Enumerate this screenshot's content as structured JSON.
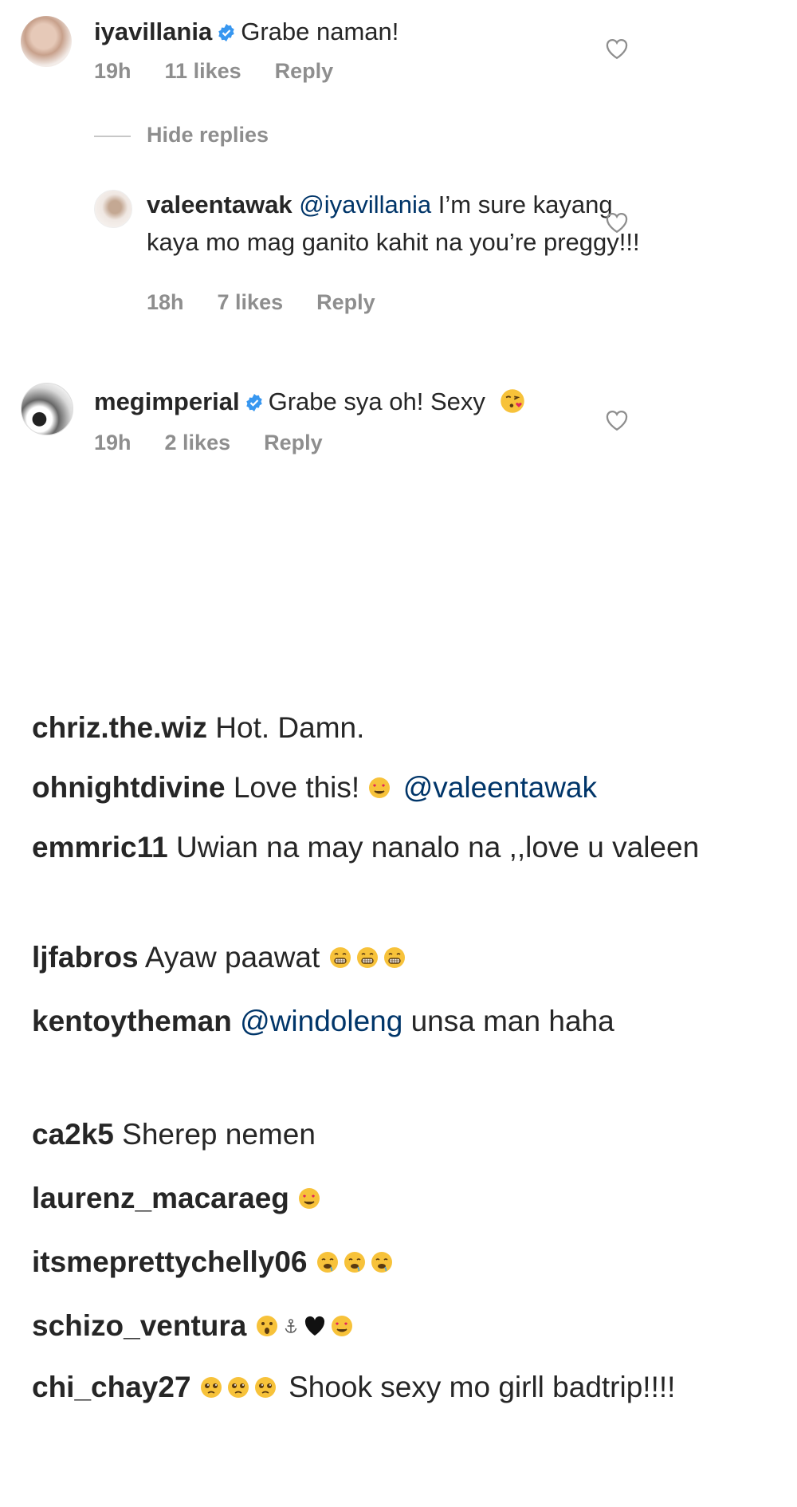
{
  "comments_threaded": [
    {
      "username": "iyavillania",
      "verified": true,
      "text": "Grabe naman!",
      "time": "19h",
      "likes": "11 likes",
      "reply_label": "Reply",
      "hide_replies_label": "Hide replies",
      "replies": [
        {
          "username": "valeentawak",
          "mention": "@iyavillania",
          "text": "I’m sure kayang kaya mo mag ganito kahit na you’re preggy!!!",
          "time": "18h",
          "likes": "7 likes",
          "reply_label": "Reply"
        }
      ]
    },
    {
      "username": "megimperial",
      "verified": true,
      "text": "Grabe sya oh! Sexy",
      "emoji": "kiss-face",
      "time": "19h",
      "likes": "2 likes",
      "reply_label": "Reply"
    }
  ],
  "comments_plain": [
    {
      "username": "chriz.the.wiz",
      "text": "Hot. Damn."
    },
    {
      "username": "ohnightdivine",
      "text": "Love this!",
      "emoji": "heart-eyes",
      "mention": "@valeentawak"
    },
    {
      "username": "emmric11",
      "text": "Uwian na may nanalo na ,,love u valeen"
    },
    {
      "username": "ljfabros",
      "text": "Ayaw paawat",
      "emoji": "grimace x3"
    },
    {
      "username": "kentoytheman",
      "mention": "@windoleng",
      "text": "unsa man haha"
    },
    {
      "username": "ca2k5",
      "text": "Sherep nemen"
    },
    {
      "username": "laurenz_macaraeg",
      "emoji": "heart-eyes"
    },
    {
      "username": "itsmeprettychelly06",
      "emoji": "drool x3"
    },
    {
      "username": "schizo_ventura",
      "emoji": "astonished, anchor, black-heart, heart-eyes"
    },
    {
      "username": "chi_chay27",
      "emoji": "pleading x3",
      "text": "Shook sexy mo girll badtrip!!!!"
    }
  ],
  "colors": {
    "text": "#262626",
    "meta": "#8e8e8e",
    "mention": "#003569",
    "verified": "#3897f0"
  }
}
